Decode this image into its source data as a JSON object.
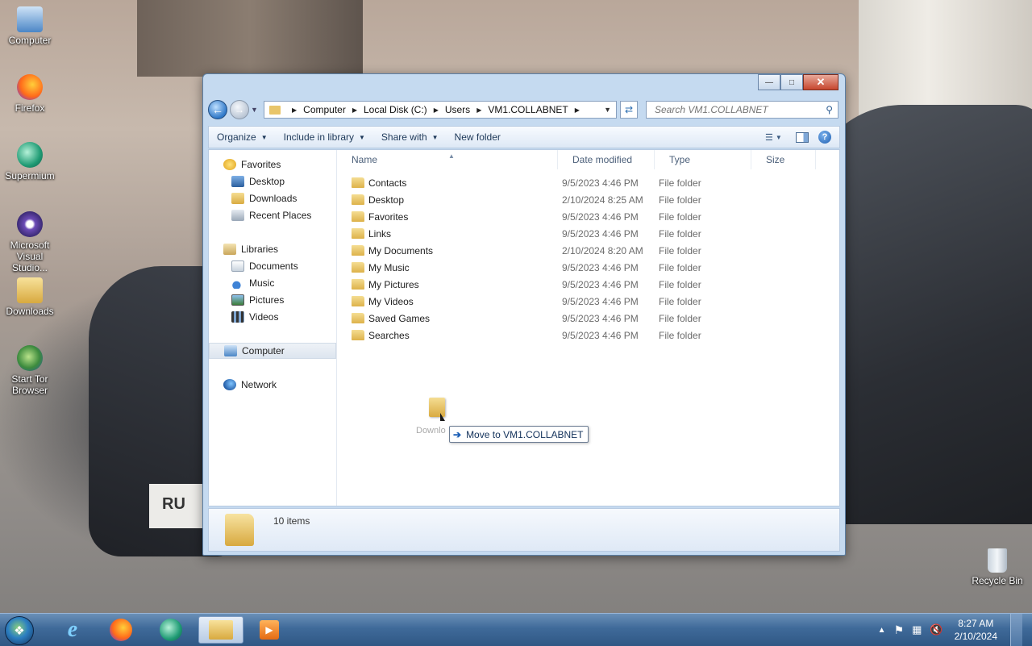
{
  "desktop": {
    "icons": [
      {
        "label": "Computer",
        "icon": "computer-icon"
      },
      {
        "label": "Firefox",
        "icon": "firefox-icon"
      },
      {
        "label": "Supermium",
        "icon": "supermium-icon"
      },
      {
        "label": "Microsoft Visual Studio...",
        "icon": "visual-studio-icon"
      },
      {
        "label": "Downloads",
        "icon": "folder-icon"
      },
      {
        "label": "Start Tor Browser",
        "icon": "tor-icon"
      }
    ],
    "recycle_bin": "Recycle Bin",
    "plate_text": "RU"
  },
  "window": {
    "breadcrumb": [
      "Computer",
      "Local Disk (C:)",
      "Users",
      "VM1.COLLABNET"
    ],
    "search_placeholder": "Search VM1.COLLABNET",
    "toolbar": {
      "organize": "Organize",
      "include": "Include in library",
      "share": "Share with",
      "new_folder": "New folder"
    },
    "nav": {
      "favorites": "Favorites",
      "desktop": "Desktop",
      "downloads": "Downloads",
      "recent": "Recent Places",
      "libraries": "Libraries",
      "documents": "Documents",
      "music": "Music",
      "pictures": "Pictures",
      "videos": "Videos",
      "computer": "Computer",
      "network": "Network"
    },
    "columns": {
      "name": "Name",
      "date": "Date modified",
      "type": "Type",
      "size": "Size"
    },
    "files": [
      {
        "name": "Contacts",
        "date": "9/5/2023 4:46 PM",
        "type": "File folder"
      },
      {
        "name": "Desktop",
        "date": "2/10/2024 8:25 AM",
        "type": "File folder"
      },
      {
        "name": "Favorites",
        "date": "9/5/2023 4:46 PM",
        "type": "File folder"
      },
      {
        "name": "Links",
        "date": "9/5/2023 4:46 PM",
        "type": "File folder"
      },
      {
        "name": "My Documents",
        "date": "2/10/2024 8:20 AM",
        "type": "File folder"
      },
      {
        "name": "My Music",
        "date": "9/5/2023 4:46 PM",
        "type": "File folder"
      },
      {
        "name": "My Pictures",
        "date": "9/5/2023 4:46 PM",
        "type": "File folder"
      },
      {
        "name": "My Videos",
        "date": "9/5/2023 4:46 PM",
        "type": "File folder"
      },
      {
        "name": "Saved Games",
        "date": "9/5/2023 4:46 PM",
        "type": "File folder"
      },
      {
        "name": "Searches",
        "date": "9/5/2023 4:46 PM",
        "type": "File folder"
      }
    ],
    "drag": {
      "ghost_label": "Downlo",
      "tooltip": "Move to VM1.COLLABNET"
    },
    "status": "10 items"
  },
  "taskbar": {
    "apps": [
      "internet-explorer-icon",
      "firefox-icon",
      "supermium-icon",
      "explorer-icon",
      "media-player-icon"
    ],
    "time": "8:27 AM",
    "date": "2/10/2024"
  },
  "colors": {
    "accent": "#2f78c8",
    "taskbar": "#3f6a99",
    "close": "#c6462e"
  }
}
